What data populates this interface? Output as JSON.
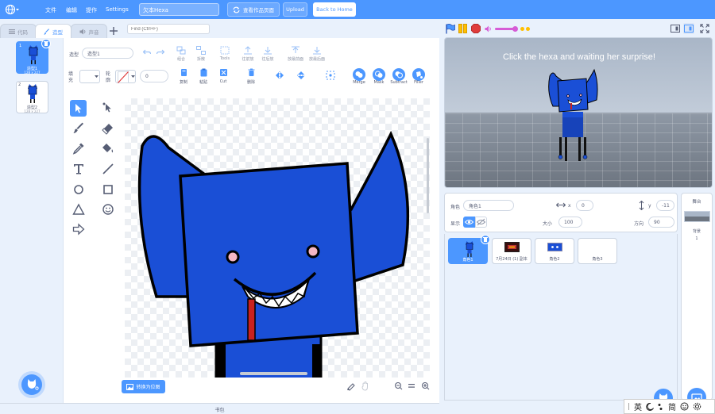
{
  "menubar": {
    "file": "文件",
    "edit": "编辑",
    "tutorials": "提作",
    "settings": "Settings",
    "project_title": "欠本Hexa",
    "see_project": "查看作品页面",
    "upload": "Upload",
    "back_home": "Back to Home"
  },
  "tabs": {
    "code": "代码",
    "costumes": "造型",
    "sounds": "声音"
  },
  "find": {
    "placeholder": "Find (Ctrl+F)"
  },
  "costumes": [
    {
      "num": "1",
      "name": "造型1",
      "size": "128 x 227"
    },
    {
      "num": "2",
      "name": "造型2",
      "size": "128 x 227"
    }
  ],
  "editor": {
    "costume_label": "造型",
    "costume_name": "造型1",
    "fill_label": "填充",
    "outline_label": "轮廓",
    "outline_value": "0",
    "tools_top": [
      "组合",
      "拆散",
      "Tools",
      "往前放",
      "往后放",
      "放最前面",
      "放最后面"
    ],
    "copy": "复制",
    "paste": "粘贴",
    "cut": "Cut",
    "delete": "删除",
    "merge": "Merge",
    "mask": "Mask",
    "subtract": "Subtract",
    "filler": "Filler",
    "convert_bitmap": "转换为位图"
  },
  "stage": {
    "message": "Click the hexa and waiting her surprise!"
  },
  "sprite_info": {
    "sprite_label": "角色",
    "sprite_name": "角色1",
    "x_label": "x",
    "x_value": "0",
    "y_label": "y",
    "y_value": "-11",
    "show_label": "显示",
    "size_label": "大小",
    "size_value": "100",
    "direction_label": "方向",
    "direction_value": "90"
  },
  "sprites": [
    {
      "name": "角色1"
    },
    {
      "name": "7月24日 (1) 副本"
    },
    {
      "name": "角色2"
    },
    {
      "name": "角色3"
    }
  ],
  "stage_panel": {
    "title": "舞台",
    "backdrop_label": "背景",
    "backdrop_count": "1"
  },
  "backpack": "书包",
  "ime": {
    "lang": "英",
    "simplified": "简"
  },
  "colors": {
    "accent": "#4c97ff",
    "hexa_blue": "#1a4fd6",
    "record": "#e03c3c",
    "volume": "#d65cd6"
  }
}
